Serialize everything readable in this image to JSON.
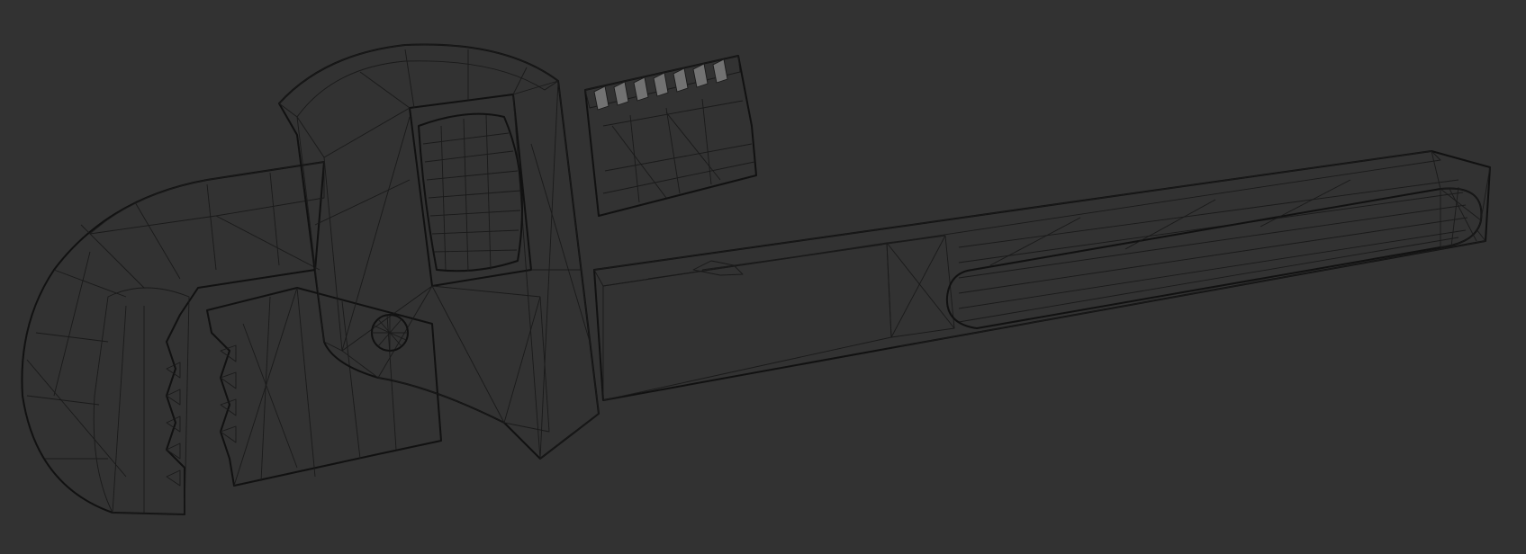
{
  "viewport": {
    "background": "#323232",
    "mesh_base_color": "#6a6a6a",
    "mesh_light_color": "#7a7a7a",
    "mesh_shadow_color": "#4e4e4e",
    "wire_color": "#1a1a1a",
    "display_mode": "solid-wireframe"
  },
  "model": {
    "object": "pipe-wrench",
    "parts": [
      "hook-jaw",
      "heel-jaw",
      "adjusting-nut",
      "frame",
      "handle",
      "hanging-hole",
      "rivet"
    ]
  }
}
